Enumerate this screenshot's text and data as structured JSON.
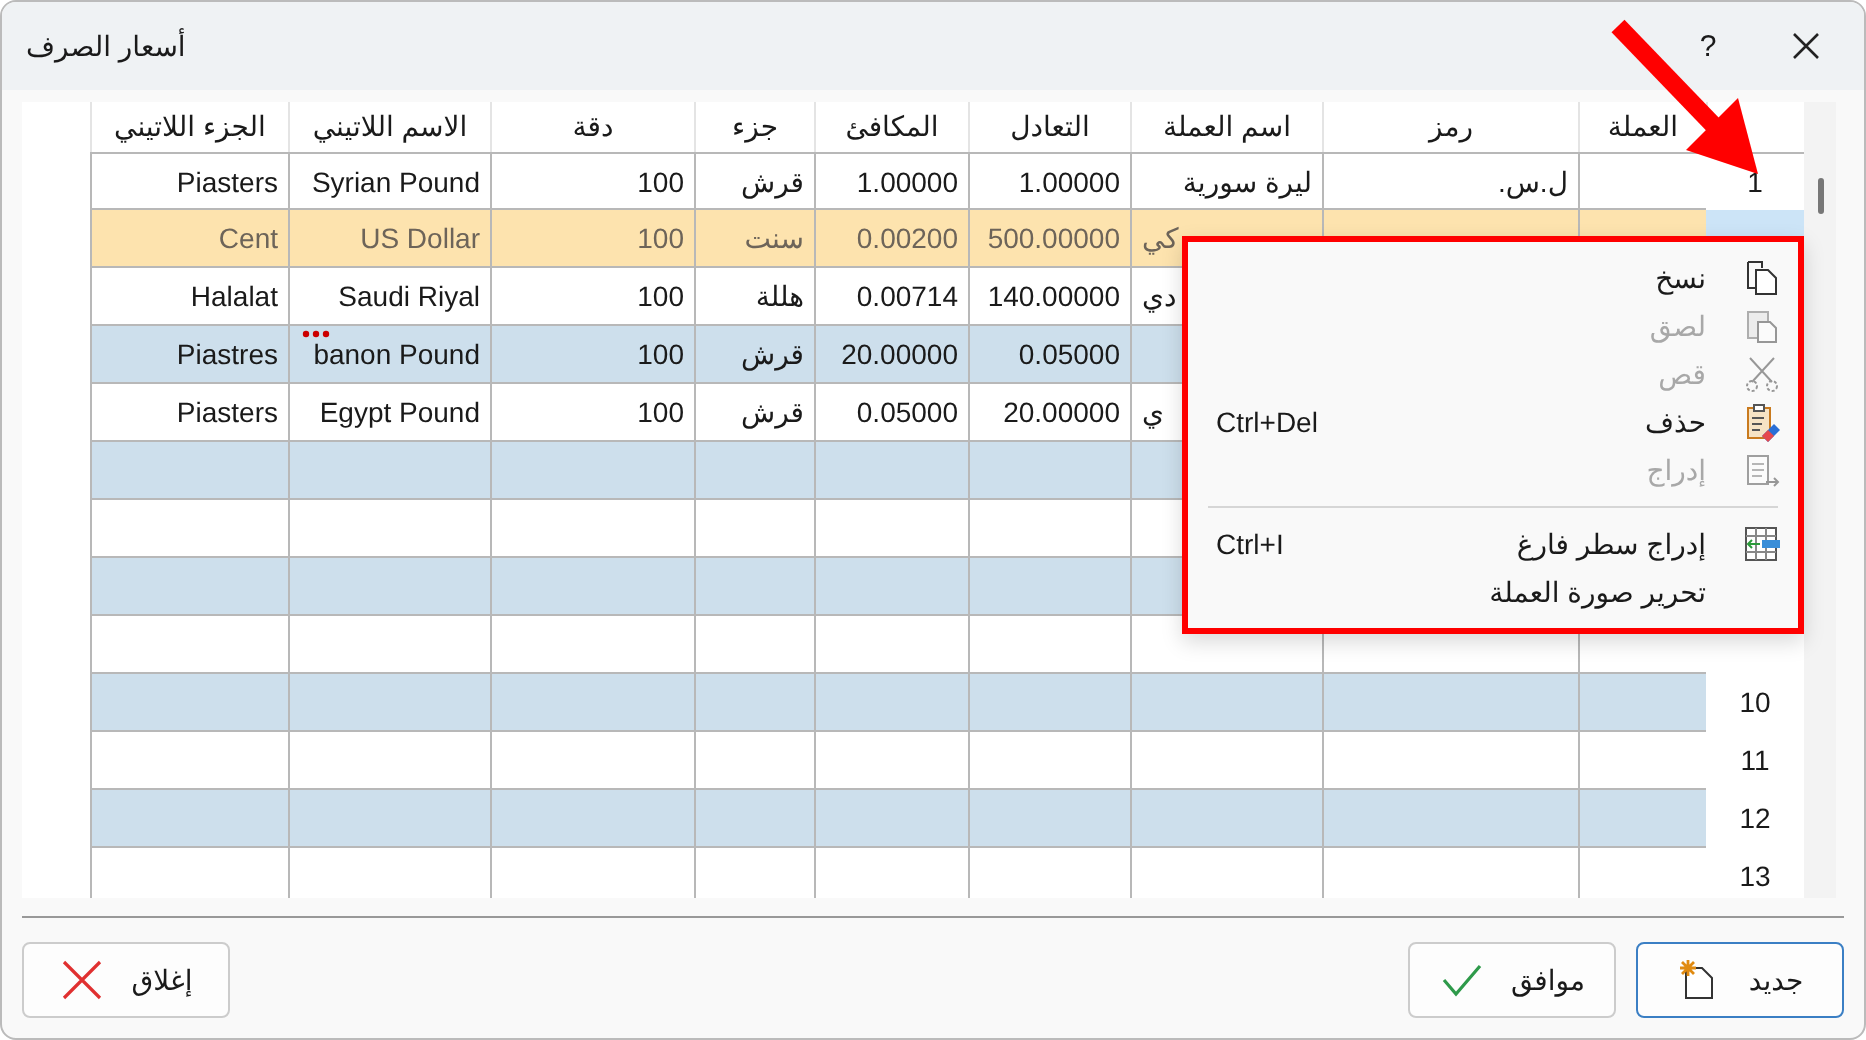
{
  "window": {
    "title": "أسعار الصرف",
    "help": "?"
  },
  "table": {
    "columns": [
      "العملة",
      "رمز",
      "اسم العملة",
      "التعادل",
      "المكافئ",
      "جزء",
      "دقة",
      "الاسم اللاتيني",
      "الجزء اللاتيني"
    ],
    "rows": [
      {
        "number": "1",
        "selected": false,
        "cells": [
          null,
          {
            "text": "ل.س."
          },
          {
            "text": "ليرة سورية"
          },
          {
            "text": "1.00000"
          },
          {
            "text": "1.00000"
          },
          {
            "text": "قرش"
          },
          {
            "text": "100"
          },
          {
            "text": "Syrian Pound"
          },
          {
            "text": "Piasters"
          }
        ]
      },
      {
        "selected": true,
        "cells": [
          null,
          null,
          {
            "text": "كي",
            "clipped": true
          },
          {
            "text": "500.00000"
          },
          {
            "text": "0.00200"
          },
          {
            "text": "سنت"
          },
          {
            "text": "100"
          },
          {
            "text": "US Dollar"
          },
          {
            "text": "Cent"
          }
        ]
      },
      {
        "selected": false,
        "cells": [
          null,
          null,
          {
            "text": "دي",
            "clipped": true
          },
          {
            "text": "140.00000"
          },
          {
            "text": "0.00714"
          },
          {
            "text": "هللة"
          },
          {
            "text": "100"
          },
          {
            "text": "Saudi Riyal"
          },
          {
            "text": "Halalat"
          }
        ]
      },
      {
        "selected": false,
        "cells": [
          null,
          null,
          null,
          {
            "text": "0.05000"
          },
          {
            "text": "20.00000"
          },
          {
            "text": "قرش"
          },
          {
            "text": "100"
          },
          {
            "text": "banon Pound",
            "overflow": true
          },
          {
            "text": "Piastres"
          }
        ]
      },
      {
        "selected": false,
        "cells": [
          null,
          null,
          {
            "text": "ي",
            "clipped": true
          },
          {
            "text": "20.00000"
          },
          {
            "text": "0.05000"
          },
          {
            "text": "قرش"
          },
          {
            "text": "100"
          },
          {
            "text": "Egypt Pound"
          },
          {
            "text": "Piasters"
          }
        ]
      },
      {
        "selected": false,
        "cells": []
      },
      {
        "selected": false,
        "cells": []
      },
      {
        "selected": false,
        "cells": []
      },
      {
        "selected": false,
        "cells": []
      },
      {
        "number": "10",
        "selected": false,
        "cells": []
      },
      {
        "number": "11",
        "selected": false,
        "cells": []
      },
      {
        "number": "12",
        "selected": false,
        "cells": []
      },
      {
        "number": "13",
        "selected": false,
        "cells": []
      }
    ]
  },
  "context_menu": {
    "items": [
      {
        "kind": "item",
        "label": "نسخ",
        "disabled": false
      },
      {
        "kind": "item",
        "label": "لصق",
        "disabled": true
      },
      {
        "kind": "item",
        "label": "قص",
        "disabled": true
      },
      {
        "kind": "item",
        "label": "حذف",
        "shortcut": "Ctrl+Del",
        "disabled": false
      },
      {
        "kind": "item",
        "label": "إدراج",
        "disabled": true
      },
      {
        "kind": "separator"
      },
      {
        "kind": "item",
        "label": "إدراج سطر فارغ",
        "shortcut": "Ctrl+I",
        "disabled": false
      },
      {
        "kind": "item",
        "label": "تحرير صورة العملة",
        "disabled": false
      }
    ]
  },
  "buttons": [
    {
      "kind": "new",
      "label": "جديد"
    },
    {
      "kind": "ok",
      "label": "موافق"
    },
    {
      "kind": "close",
      "label": "إغلاق"
    }
  ]
}
